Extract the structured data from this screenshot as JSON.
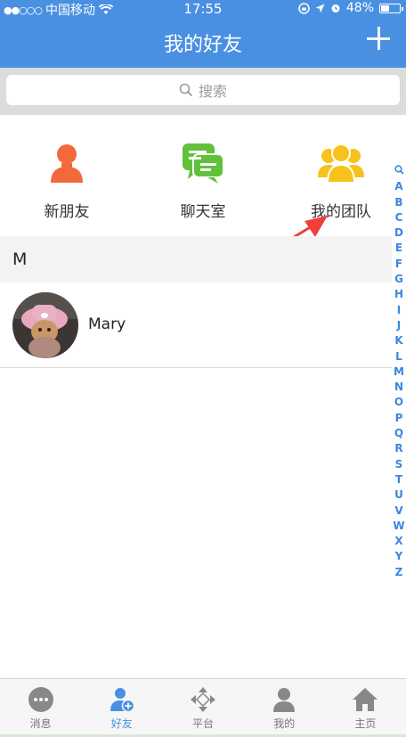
{
  "status_bar": {
    "carrier": "中国移动",
    "time": "17:55",
    "battery_text": "48%",
    "battery_level": 0.48
  },
  "header": {
    "title": "我的好友"
  },
  "search": {
    "placeholder": "搜索"
  },
  "quick_actions": [
    {
      "label": "新朋友",
      "color": "#f26a3c"
    },
    {
      "label": "聊天室",
      "color": "#62c13b"
    },
    {
      "label": "我的团队",
      "color": "#f7c21b"
    }
  ],
  "sections": [
    {
      "letter": "M",
      "contacts": [
        {
          "name": "Mary"
        }
      ]
    }
  ],
  "index": [
    "A",
    "B",
    "C",
    "D",
    "E",
    "F",
    "G",
    "H",
    "I",
    "J",
    "K",
    "L",
    "M",
    "N",
    "O",
    "P",
    "Q",
    "R",
    "S",
    "T",
    "U",
    "V",
    "W",
    "X",
    "Y",
    "Z"
  ],
  "tabs": [
    {
      "label": "消息",
      "icon": "message-bubble-icon",
      "active": false
    },
    {
      "label": "好友",
      "icon": "friends-icon",
      "active": true
    },
    {
      "label": "平台",
      "icon": "platform-icon",
      "active": false
    },
    {
      "label": "我的",
      "icon": "profile-icon",
      "active": false
    },
    {
      "label": "主页",
      "icon": "home-icon",
      "active": false
    }
  ],
  "colors": {
    "header_bg": "#4a90e2",
    "index_text": "#3a86e4",
    "annotation_arrow": "#f23d3d"
  }
}
